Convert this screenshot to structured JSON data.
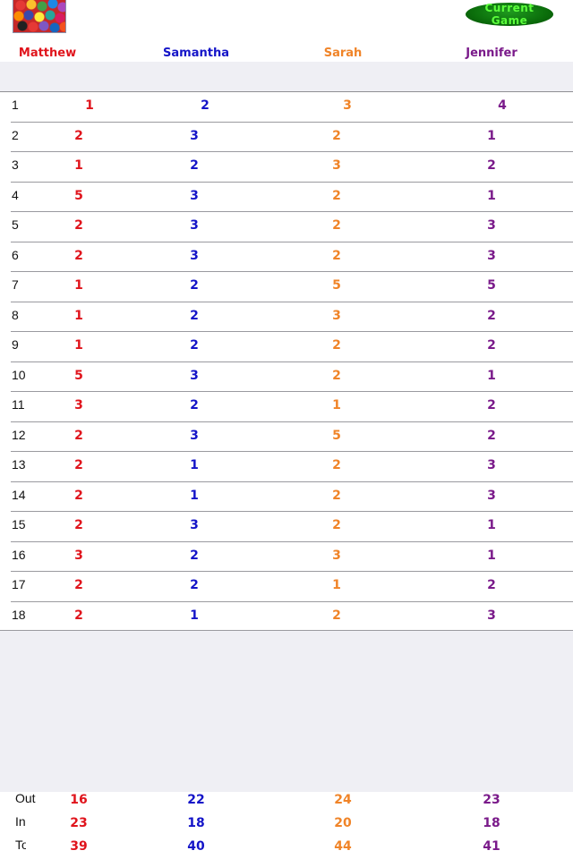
{
  "header": {
    "logo_icon": "gumballs-thumbnail",
    "current_game_label": "Current Game"
  },
  "players": [
    {
      "name": "Matthew",
      "color": "#e0141c"
    },
    {
      "name": "Samantha",
      "color": "#1414c8"
    },
    {
      "name": "Sarah",
      "color": "#f08428"
    },
    {
      "name": "Jennifer",
      "color": "#7a1a8a"
    }
  ],
  "holes": [
    {
      "hole": "1",
      "scores": [
        "1",
        "2",
        "3",
        "4"
      ]
    },
    {
      "hole": "2",
      "scores": [
        "2",
        "3",
        "2",
        "1"
      ]
    },
    {
      "hole": "3",
      "scores": [
        "1",
        "2",
        "3",
        "2"
      ]
    },
    {
      "hole": "4",
      "scores": [
        "5",
        "3",
        "2",
        "1"
      ]
    },
    {
      "hole": "5",
      "scores": [
        "2",
        "3",
        "2",
        "3"
      ]
    },
    {
      "hole": "6",
      "scores": [
        "2",
        "3",
        "2",
        "3"
      ]
    },
    {
      "hole": "7",
      "scores": [
        "1",
        "2",
        "5",
        "5"
      ]
    },
    {
      "hole": "8",
      "scores": [
        "1",
        "2",
        "3",
        "2"
      ]
    },
    {
      "hole": "9",
      "scores": [
        "1",
        "2",
        "2",
        "2"
      ]
    },
    {
      "hole": "10",
      "scores": [
        "5",
        "3",
        "2",
        "1"
      ]
    },
    {
      "hole": "11",
      "scores": [
        "3",
        "2",
        "1",
        "2"
      ]
    },
    {
      "hole": "12",
      "scores": [
        "2",
        "3",
        "5",
        "2"
      ]
    },
    {
      "hole": "13",
      "scores": [
        "2",
        "1",
        "2",
        "3"
      ]
    },
    {
      "hole": "14",
      "scores": [
        "2",
        "1",
        "2",
        "3"
      ]
    },
    {
      "hole": "15",
      "scores": [
        "2",
        "3",
        "2",
        "1"
      ]
    },
    {
      "hole": "16",
      "scores": [
        "3",
        "2",
        "3",
        "1"
      ]
    },
    {
      "hole": "17",
      "scores": [
        "2",
        "2",
        "1",
        "2"
      ]
    },
    {
      "hole": "18",
      "scores": [
        "2",
        "1",
        "2",
        "3"
      ]
    }
  ],
  "summary": [
    {
      "label": "Out",
      "values": [
        "16",
        "22",
        "24",
        "23"
      ]
    },
    {
      "label": "In",
      "values": [
        "23",
        "18",
        "20",
        "18"
      ]
    },
    {
      "label": "Total",
      "values": [
        "39",
        "40",
        "44",
        "41"
      ]
    }
  ]
}
